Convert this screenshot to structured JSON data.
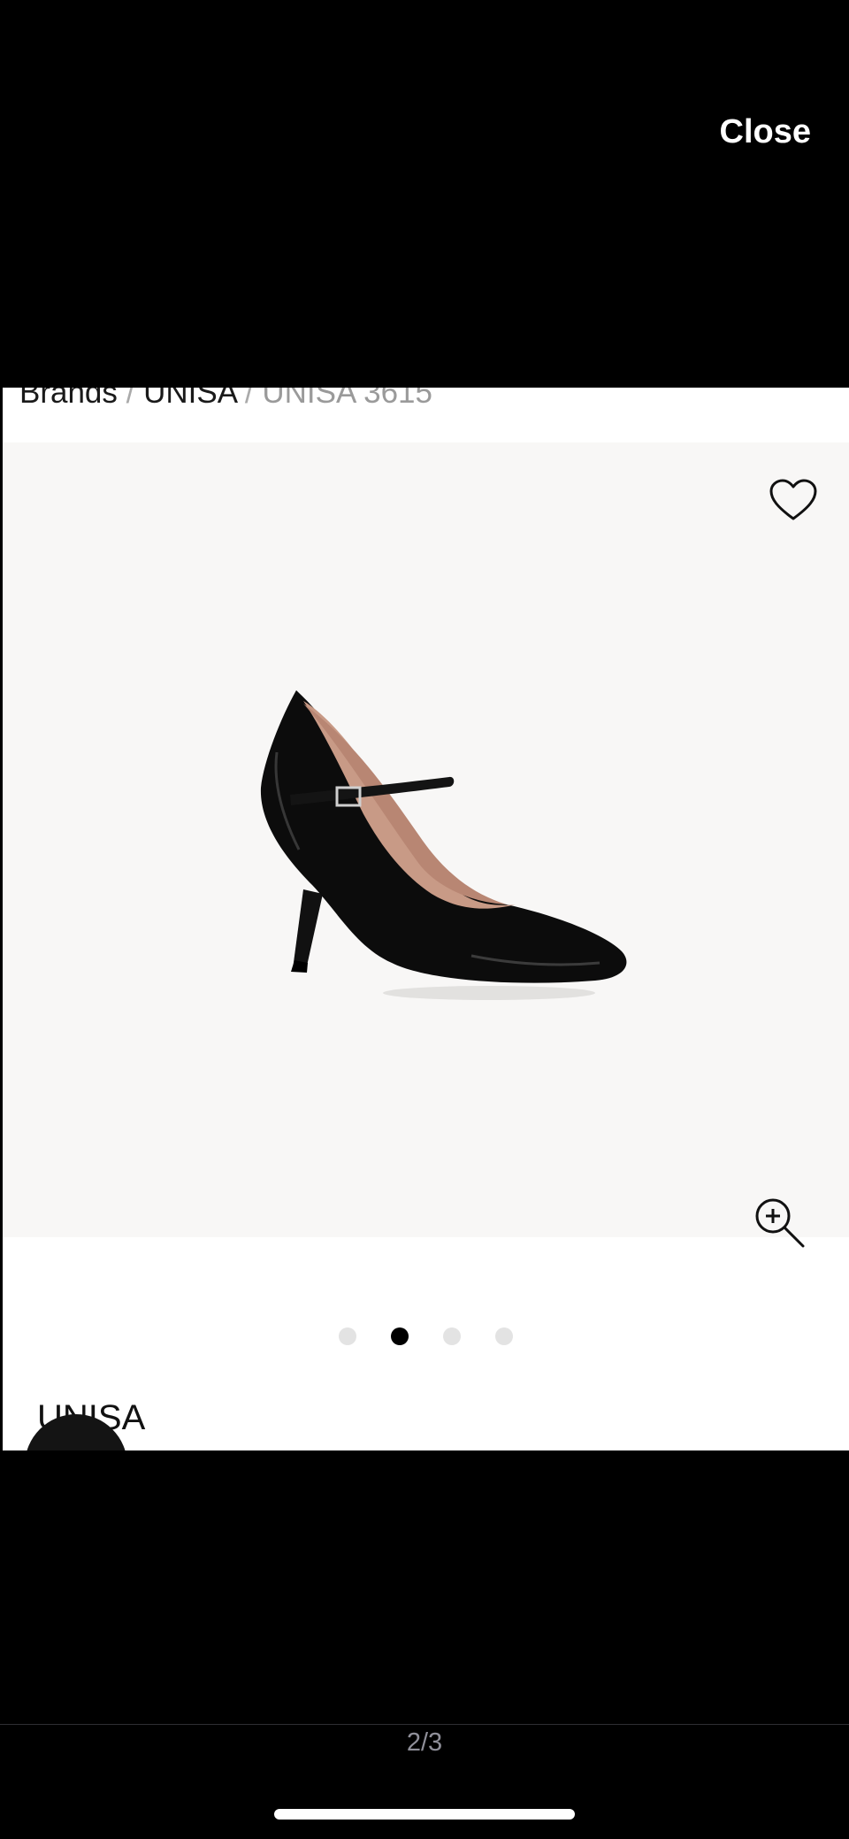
{
  "header": {
    "close_label": "Close"
  },
  "breadcrumb": {
    "items": [
      "Brands",
      "UNISA",
      "UNISA 3615"
    ],
    "separator": "/"
  },
  "product": {
    "image_icon": "black-patent-mary-jane-pump",
    "favorite_icon": "heart-icon",
    "zoom_icon": "zoom-in-icon",
    "carousel": {
      "count": 4,
      "active_index": 1
    },
    "brand": "UNISA"
  },
  "footer": {
    "page_counter": "2/3"
  },
  "colors": {
    "background": "#000000",
    "panel": "#ffffff",
    "image_bg": "#f8f7f6",
    "dot_active": "#000000",
    "dot_inactive": "#e3e3e3"
  }
}
